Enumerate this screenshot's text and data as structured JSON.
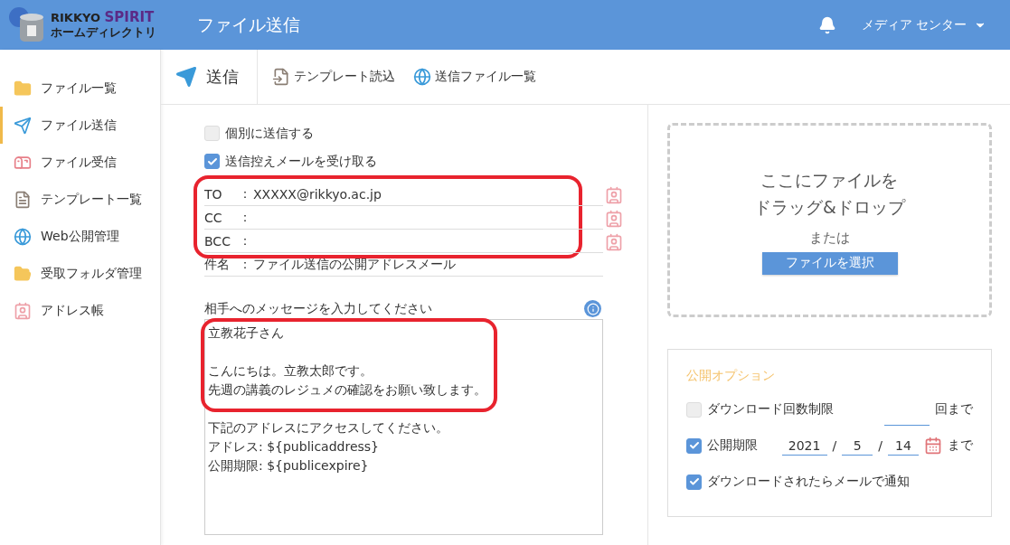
{
  "header": {
    "logo_top": "RIKKYO ",
    "logo_accent": "SPIRIT",
    "logo_sub": "ホームディレクトリ",
    "title": "ファイル送信",
    "user": "メディア センター"
  },
  "sidebar": {
    "items": [
      {
        "label": "ファイル一覧",
        "selected": false
      },
      {
        "label": "ファイル送信",
        "selected": true
      },
      {
        "label": "ファイル受信",
        "selected": false
      },
      {
        "label": "テンプレート一覧",
        "selected": false
      },
      {
        "label": "Web公開管理",
        "selected": false
      },
      {
        "label": "受取フォルダ管理",
        "selected": false
      },
      {
        "label": "アドレス帳",
        "selected": false
      }
    ]
  },
  "toolbar": {
    "title": "送信",
    "actions": [
      "テンプレート読込",
      "送信ファイル一覧"
    ]
  },
  "form": {
    "options": [
      {
        "label": "個別に送信する",
        "checked": false
      },
      {
        "label": "送信控えメールを受け取る",
        "checked": true
      }
    ],
    "address_group": {
      "highlighted": true,
      "rows": [
        {
          "label": "TO",
          "colon": "：",
          "value": "XXXXX@rikkyo.ac.jp"
        },
        {
          "label": "CC",
          "colon": "："
        },
        {
          "label": "BCC",
          "colon": "："
        }
      ]
    },
    "subject": {
      "label": "件名",
      "colon": "：",
      "value": "ファイル送信の公開アドレスメール"
    },
    "message_label": "相手へのメッセージを入力してください",
    "message": {
      "highlighted_paragraphs": [
        [
          "立教花子さん"
        ],
        [
          "こんにちは。立教太郎です。",
          "先週の講義のレジュメの確認をお願い致します。"
        ]
      ],
      "paragraphs": [
        [
          "下記のアドレスにアクセスしてください。",
          "アドレス: ${publicaddress}",
          "公開期限: ${publicexpire}"
        ]
      ]
    }
  },
  "dropzone": {
    "heading_lines": [
      "ここにファイルを",
      "ドラッグ&ドロップ"
    ],
    "or": "または",
    "button": "ファイルを選択"
  },
  "publish_options": {
    "title": "公開オプション",
    "rows": [
      {
        "kind": "count",
        "label": "ダウンロード回数制限",
        "checked": false,
        "suffix": "回まで"
      },
      {
        "kind": "date",
        "label": "公開期限",
        "checked": true,
        "year": "2021",
        "sep1": "/",
        "month": "5",
        "sep2": "/",
        "day": "14",
        "suffix": "まで"
      },
      {
        "kind": "plain",
        "label": "ダウンロードされたらメールで通知",
        "checked": true
      }
    ]
  }
}
